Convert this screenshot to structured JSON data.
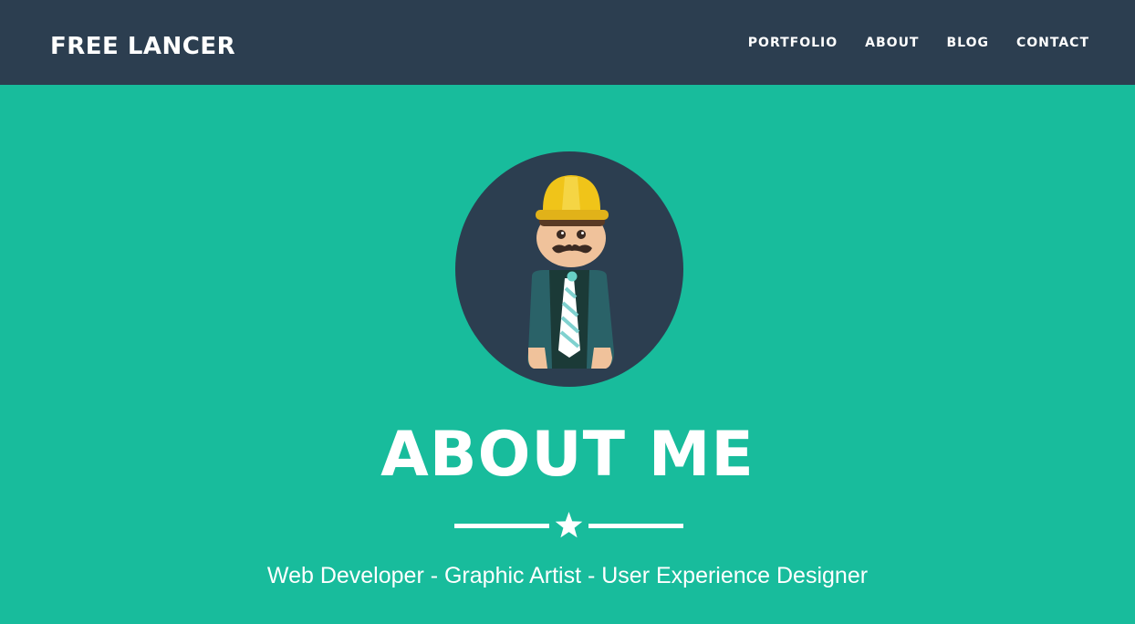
{
  "header": {
    "brand": "FREE LANCER",
    "nav": [
      {
        "label": "PORTFOLIO"
      },
      {
        "label": "ABOUT"
      },
      {
        "label": "BLOG"
      },
      {
        "label": "CONTACT"
      }
    ]
  },
  "hero": {
    "avatar_icon": "freelancer-avatar-icon",
    "title": "ABOUT ME",
    "divider_icon": "star-icon",
    "subtitle": "Web Developer - Graphic Artist - User Experience Designer"
  },
  "colors": {
    "navbar": "#2c3e50",
    "background": "#18bc9c",
    "text": "#ffffff",
    "hat": "#f0c419"
  }
}
